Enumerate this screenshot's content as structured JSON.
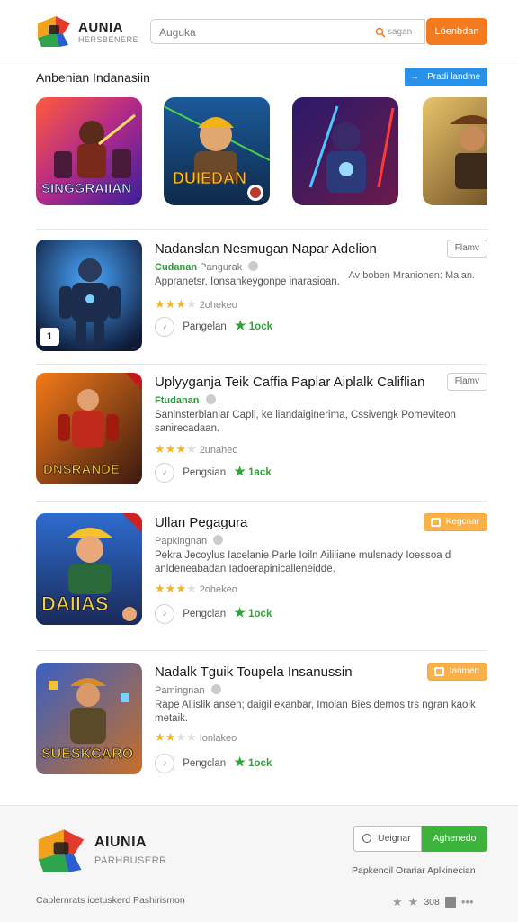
{
  "header": {
    "brand_name": "AUNIA",
    "brand_sub": "HERSBENERE",
    "search_placeholder": "Auguka",
    "search_label": "sagan",
    "search_button": "Löenbdan"
  },
  "featured": {
    "title": "Anbenian Indanasiin",
    "button_label": "Pradi landme",
    "tiles": [
      {
        "caption": "SINGGRAIIAN",
        "colors": [
          "#ff5a3c",
          "#6a2bd8"
        ]
      },
      {
        "caption": "DUIEDAN",
        "colors": [
          "#1c3c7a",
          "#f2a62a"
        ]
      },
      {
        "caption": "",
        "colors": [
          "#2a1a6a",
          "#e23a5a"
        ]
      },
      {
        "caption": "",
        "colors": [
          "#c99a2e",
          "#4a3420"
        ]
      }
    ]
  },
  "apps": [
    {
      "title": "Nadanslan Nesmugan Napar Adelion",
      "dev_green": "Cudanan",
      "dev": "Pangurak",
      "desc": "Appranetsr, Ionsankeygonpe inarasioan.",
      "side_note": "Av boben Mranionen: Malan.",
      "rating_stars": 3,
      "rating_label": "2ohekeo",
      "action": "Pangelan",
      "lock": "1ock",
      "tag": "Flamv",
      "tag_style": "plain",
      "thumb_badge": "1",
      "thumb_caption": "",
      "thumb_colors": [
        "#1d3a6e",
        "#0e1a38"
      ]
    },
    {
      "title": "Uplyyganja Teik Caffia Paplar Aiplalk Califlian",
      "dev_green": "Ftudanan",
      "dev": "",
      "desc": "Sanlnsterblaniar Capli, ke liandaiginerima, Cssivengk Pomeviteon sanirecadaan.",
      "side_note": "",
      "rating_stars": 3,
      "rating_label": "2unaheo",
      "action": "Pengsian",
      "lock": "1ack",
      "tag": "Flamv",
      "tag_style": "plain",
      "thumb_badge": "",
      "thumb_caption": "DNSRANDE",
      "thumb_colors": [
        "#d8571c",
        "#3a1a10"
      ]
    },
    {
      "title": "Ullan Pegagura",
      "dev_green": "",
      "dev": "Papkingnan",
      "desc": "Pekra Jecoylus Iacelanie Parle Ioiln Aililiane mulsnady Ioessoa d anldeneabadan Iadoerapinicalleneidde.",
      "side_note": "",
      "rating_stars": 3,
      "rating_label": "2ohekeo",
      "action": "Pengclan",
      "lock": "1ock",
      "tag": "Kegcnar",
      "tag_style": "orange",
      "thumb_badge": "",
      "thumb_caption": "DAIIAS",
      "thumb_colors": [
        "#2e6ccf",
        "#f2c230"
      ]
    },
    {
      "title": "Nadalk Tguik Toupela Insanussin",
      "dev_green": "",
      "dev": "Pamingnan",
      "desc": "Rape Allislik ansen; daigil ekanbar, Imoian Bies demos trs ngran kaolk metaik.",
      "side_note": "",
      "rating_stars": 2,
      "rating_label": "Ionlakeo",
      "action": "Pengclan",
      "lock": "1ock",
      "tag": "Ianmen",
      "tag_style": "orange",
      "thumb_badge": "",
      "thumb_caption": "SUESKCARO",
      "thumb_colors": [
        "#3a5fc2",
        "#c76f28"
      ]
    }
  ],
  "footer": {
    "brand_name": "AIUNIA",
    "brand_sub": "PARHBUSERR",
    "button_outline": "Ueignar",
    "button_primary": "Aghenedo",
    "tagline": "Papkenoil Orariar Aplkinecian",
    "copyright": "Caplernrats icetuskerd Pashirismon",
    "count": "308"
  }
}
